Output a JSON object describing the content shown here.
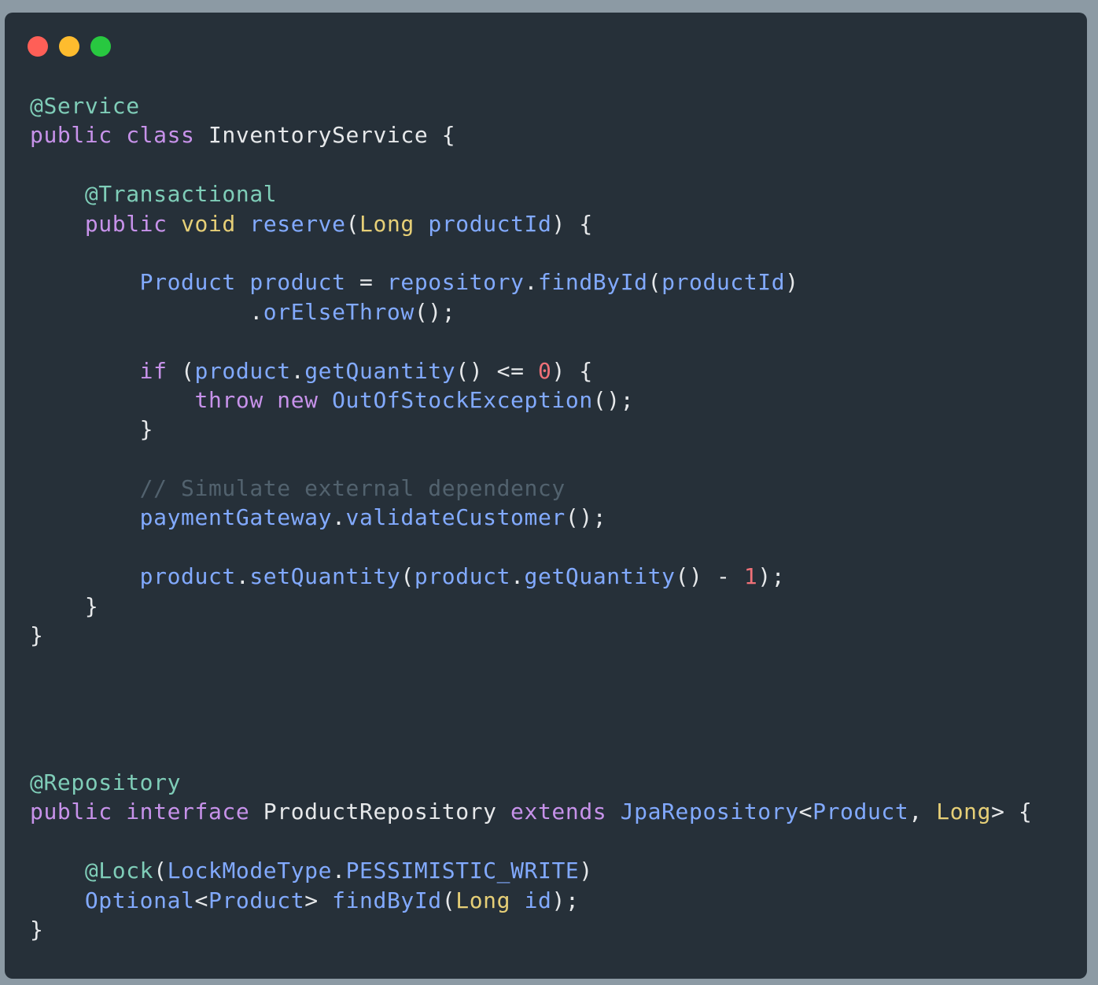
{
  "window": {
    "controls": [
      {
        "name": "close-dot",
        "color": "#ff5f57"
      },
      {
        "name": "minimize-dot",
        "color": "#febc2e"
      },
      {
        "name": "zoom-dot",
        "color": "#28c840"
      }
    ]
  },
  "colors": {
    "background": "#263039",
    "annotation": "#7fcdb8",
    "keyword": "#c792ea",
    "type": "#e6cf77",
    "identifier": "#82aaff",
    "plain": "#e6e8ea",
    "number": "#f07178",
    "comment": "#52626e"
  },
  "code": {
    "lines": [
      [
        {
          "t": "@Service",
          "c": "annotation"
        }
      ],
      [
        {
          "t": "public class",
          "c": "keyword"
        },
        {
          "t": " InventoryService {",
          "c": "plain"
        }
      ],
      [],
      [
        {
          "t": "    ",
          "c": "plain"
        },
        {
          "t": "@Transactional",
          "c": "annotation"
        }
      ],
      [
        {
          "t": "    ",
          "c": "plain"
        },
        {
          "t": "public",
          "c": "keyword"
        },
        {
          "t": " ",
          "c": "plain"
        },
        {
          "t": "void",
          "c": "type"
        },
        {
          "t": " ",
          "c": "plain"
        },
        {
          "t": "reserve",
          "c": "identifier"
        },
        {
          "t": "(",
          "c": "plain"
        },
        {
          "t": "Long",
          "c": "type"
        },
        {
          "t": " ",
          "c": "plain"
        },
        {
          "t": "productId",
          "c": "identifier"
        },
        {
          "t": ") {",
          "c": "plain"
        }
      ],
      [],
      [
        {
          "t": "        ",
          "c": "plain"
        },
        {
          "t": "Product product",
          "c": "identifier"
        },
        {
          "t": " = ",
          "c": "plain"
        },
        {
          "t": "repository",
          "c": "identifier"
        },
        {
          "t": ".",
          "c": "plain"
        },
        {
          "t": "findById",
          "c": "identifier"
        },
        {
          "t": "(",
          "c": "plain"
        },
        {
          "t": "productId",
          "c": "identifier"
        },
        {
          "t": ")",
          "c": "plain"
        }
      ],
      [
        {
          "t": "                .",
          "c": "plain"
        },
        {
          "t": "orElseThrow",
          "c": "identifier"
        },
        {
          "t": "();",
          "c": "plain"
        }
      ],
      [],
      [
        {
          "t": "        ",
          "c": "plain"
        },
        {
          "t": "if",
          "c": "keyword"
        },
        {
          "t": " (",
          "c": "plain"
        },
        {
          "t": "product",
          "c": "identifier"
        },
        {
          "t": ".",
          "c": "plain"
        },
        {
          "t": "getQuantity",
          "c": "identifier"
        },
        {
          "t": "() <= ",
          "c": "plain"
        },
        {
          "t": "0",
          "c": "number"
        },
        {
          "t": ") {",
          "c": "plain"
        }
      ],
      [
        {
          "t": "            ",
          "c": "plain"
        },
        {
          "t": "throw new",
          "c": "keyword"
        },
        {
          "t": " ",
          "c": "plain"
        },
        {
          "t": "OutOfStockException",
          "c": "identifier"
        },
        {
          "t": "();",
          "c": "plain"
        }
      ],
      [
        {
          "t": "        }",
          "c": "plain"
        }
      ],
      [],
      [
        {
          "t": "        ",
          "c": "plain"
        },
        {
          "t": "// Simulate external dependency",
          "c": "comment"
        }
      ],
      [
        {
          "t": "        ",
          "c": "plain"
        },
        {
          "t": "paymentGateway",
          "c": "identifier"
        },
        {
          "t": ".",
          "c": "plain"
        },
        {
          "t": "validateCustomer",
          "c": "identifier"
        },
        {
          "t": "();",
          "c": "plain"
        }
      ],
      [],
      [
        {
          "t": "        ",
          "c": "plain"
        },
        {
          "t": "product",
          "c": "identifier"
        },
        {
          "t": ".",
          "c": "plain"
        },
        {
          "t": "setQuantity",
          "c": "identifier"
        },
        {
          "t": "(",
          "c": "plain"
        },
        {
          "t": "product",
          "c": "identifier"
        },
        {
          "t": ".",
          "c": "plain"
        },
        {
          "t": "getQuantity",
          "c": "identifier"
        },
        {
          "t": "() - ",
          "c": "plain"
        },
        {
          "t": "1",
          "c": "number"
        },
        {
          "t": ");",
          "c": "plain"
        }
      ],
      [
        {
          "t": "    }",
          "c": "plain"
        }
      ],
      [
        {
          "t": "}",
          "c": "plain"
        }
      ],
      [],
      [],
      [],
      [],
      [
        {
          "t": "@Repository",
          "c": "annotation"
        }
      ],
      [
        {
          "t": "public interface",
          "c": "keyword"
        },
        {
          "t": " ProductRepository ",
          "c": "plain"
        },
        {
          "t": "extends",
          "c": "keyword"
        },
        {
          "t": " ",
          "c": "plain"
        },
        {
          "t": "JpaRepository",
          "c": "identifier"
        },
        {
          "t": "<",
          "c": "plain"
        },
        {
          "t": "Product",
          "c": "identifier"
        },
        {
          "t": ", ",
          "c": "plain"
        },
        {
          "t": "Long",
          "c": "type"
        },
        {
          "t": "> {",
          "c": "plain"
        }
      ],
      [],
      [
        {
          "t": "    ",
          "c": "plain"
        },
        {
          "t": "@Lock",
          "c": "annotation"
        },
        {
          "t": "(",
          "c": "plain"
        },
        {
          "t": "LockModeType",
          "c": "identifier"
        },
        {
          "t": ".",
          "c": "plain"
        },
        {
          "t": "PESSIMISTIC_WRITE",
          "c": "identifier"
        },
        {
          "t": ")",
          "c": "plain"
        }
      ],
      [
        {
          "t": "    ",
          "c": "plain"
        },
        {
          "t": "Optional",
          "c": "identifier"
        },
        {
          "t": "<",
          "c": "plain"
        },
        {
          "t": "Product",
          "c": "identifier"
        },
        {
          "t": "> ",
          "c": "plain"
        },
        {
          "t": "findById",
          "c": "identifier"
        },
        {
          "t": "(",
          "c": "plain"
        },
        {
          "t": "Long",
          "c": "type"
        },
        {
          "t": " ",
          "c": "plain"
        },
        {
          "t": "id",
          "c": "identifier"
        },
        {
          "t": ");",
          "c": "plain"
        }
      ],
      [
        {
          "t": "}",
          "c": "plain"
        }
      ]
    ]
  }
}
